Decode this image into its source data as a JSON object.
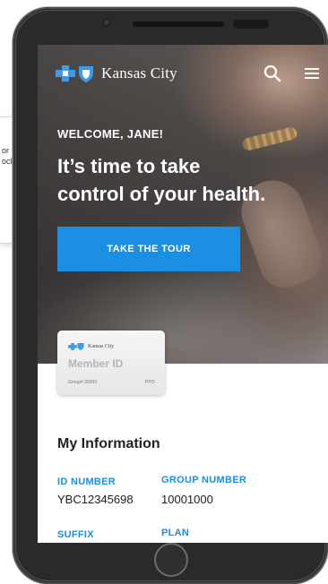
{
  "background_card": {
    "line1": "or",
    "line2": "ock"
  },
  "header": {
    "brand": "Kansas City",
    "icons": [
      "cross-logo-icon",
      "shield-logo-icon",
      "search-icon",
      "menu-icon"
    ]
  },
  "hero": {
    "welcome": "WELCOME, JANE!",
    "headline_line1": "It’s time to take",
    "headline_line2": "control of your health.",
    "cta": "TAKE THE TOUR"
  },
  "member_card": {
    "brand": "Kansas City",
    "title": "Member ID",
    "group": "Group# 00000",
    "plan": "PPO"
  },
  "info": {
    "title": "My Information",
    "id_label": "ID NUMBER",
    "id_value": "YBC12345698",
    "group_label": "GROUP NUMBER",
    "group_value": "10001000",
    "suffix_label": "SUFFIX",
    "plan_label": "PLAN"
  },
  "colors": {
    "accent_blue": "#1a8fe3",
    "phone_body": "#2a2a2c",
    "text_dark": "#222222"
  }
}
